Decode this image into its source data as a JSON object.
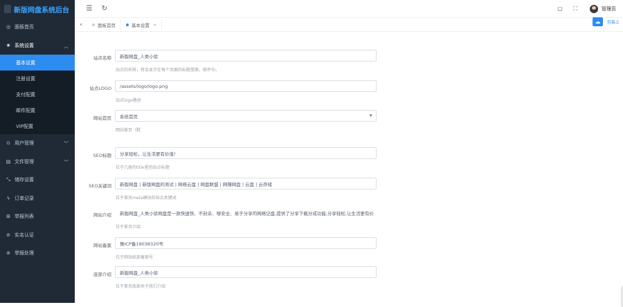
{
  "app": {
    "title": "新版网盘系统后台"
  },
  "sidebar": {
    "items": [
      {
        "label": "面板首页",
        "icon": "dashboard-icon"
      },
      {
        "label": "系统设置",
        "icon": "gear-icon"
      },
      {
        "label": "用户管理",
        "icon": "user-icon"
      },
      {
        "label": "文件管理",
        "icon": "file-icon"
      },
      {
        "label": "储存设置",
        "icon": "storage-icon"
      },
      {
        "label": "订单记录",
        "icon": "order-icon"
      },
      {
        "label": "举报列表",
        "icon": "report-icon"
      },
      {
        "label": "实名认证",
        "icon": "verify-icon"
      },
      {
        "label": "举报处理",
        "icon": "handle-icon"
      }
    ],
    "sub_items": [
      {
        "label": "基本设置"
      },
      {
        "label": "注册设置"
      },
      {
        "label": "支付配置"
      },
      {
        "label": "邮件配置"
      },
      {
        "label": "VIP配置"
      }
    ]
  },
  "header": {
    "username": "管理员"
  },
  "tabs": [
    {
      "label": "面板首页"
    },
    {
      "label": "基本设置"
    }
  ],
  "toolbar": {
    "label": "包装上"
  },
  "form": {
    "site_name": {
      "label": "站点名称",
      "value": "新版网盘_人类小徐",
      "help": "站点的名称，将会显示在每个页面的标题里面，邮件中。"
    },
    "site_logo": {
      "label": "站点LOGO",
      "value": "/assets/logo/logo.png",
      "help": "站点logo路径"
    },
    "home_page": {
      "label": "网站首页",
      "value": "系统首页",
      "help": "网站首页（默"
    },
    "seo_title": {
      "label": "SEO标题",
      "value": "分享轻松，让生活更有价值！",
      "help": "位于几类的title里的站点标题"
    },
    "seo_keywords": {
      "label": "SEO关键词",
      "value": "新版网盘 | 新版网盘的测试 | 网络云盘 | 网盘联盟 | 网赚网盘 | 云盘 | 云存储",
      "help": "位于首页meta模块的站点关键词"
    },
    "site_intro": {
      "label": "网站介绍",
      "value": "新版网盘_人类小徐网盘是一款快速快、不封杀、够安全、易于分享的网络记盘,提供了分享下载分成功能,分享轻松,让生活更有价",
      "help": "位于首页介绍"
    },
    "icp": {
      "label": "网站备案",
      "value": "豫ICP备19038320号",
      "help": "位于网站底部备案号"
    },
    "footer_intro": {
      "label": "底部介绍",
      "value": "新版网盘_人类小徐",
      "help": "位于首页底部关于我们介绍"
    }
  }
}
